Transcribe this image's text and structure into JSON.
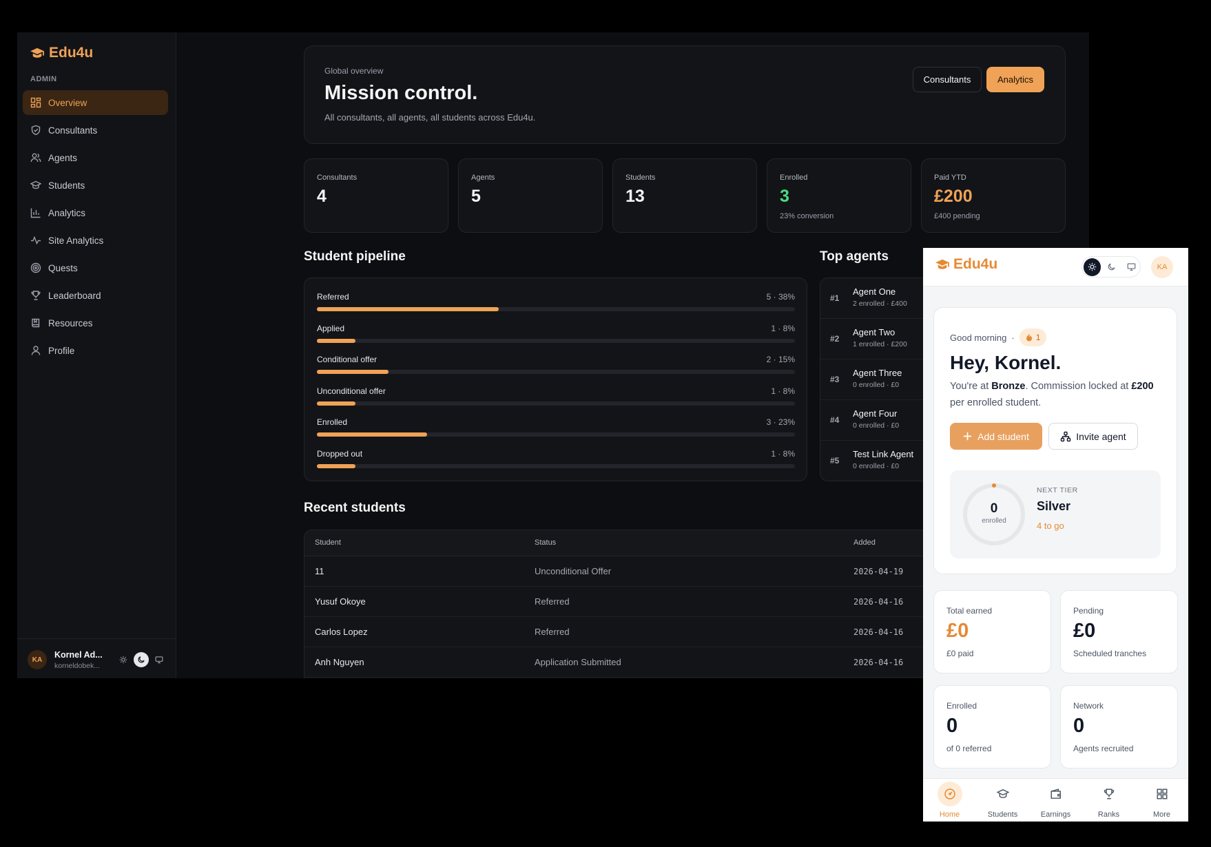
{
  "desktop": {
    "brand": "Edu4u",
    "sidebar": {
      "section_label": "ADMIN",
      "items": [
        {
          "label": "Overview",
          "icon": "grid-icon",
          "active": true
        },
        {
          "label": "Consultants",
          "icon": "shield-icon"
        },
        {
          "label": "Agents",
          "icon": "users-icon"
        },
        {
          "label": "Students",
          "icon": "graduation-cap-icon"
        },
        {
          "label": "Analytics",
          "icon": "bar-chart-icon"
        },
        {
          "label": "Site Analytics",
          "icon": "activity-icon"
        },
        {
          "label": "Quests",
          "icon": "target-icon"
        },
        {
          "label": "Leaderboard",
          "icon": "trophy-icon"
        },
        {
          "label": "Resources",
          "icon": "book-icon"
        },
        {
          "label": "Profile",
          "icon": "user-icon"
        }
      ],
      "user": {
        "initials": "KA",
        "name": "Kornel Ad...",
        "email": "korneldobek..."
      }
    },
    "hero": {
      "eyebrow": "Global overview",
      "title": "Mission control.",
      "subtitle": "All consultants, all agents, all students across Edu4u.",
      "consultants_button": "Consultants",
      "analytics_button": "Analytics"
    },
    "stats": [
      {
        "label": "Consultants",
        "value": "4",
        "sub": ""
      },
      {
        "label": "Agents",
        "value": "5",
        "sub": ""
      },
      {
        "label": "Students",
        "value": "13",
        "sub": ""
      },
      {
        "label": "Enrolled",
        "value": "3",
        "sub": "23% conversion"
      },
      {
        "label": "Paid YTD",
        "value": "£200",
        "sub": "£400 pending"
      }
    ],
    "pipeline": {
      "title": "Student pipeline",
      "rows": [
        {
          "label": "Referred",
          "value": "5 · 38%",
          "fraction": 0.38
        },
        {
          "label": "Applied",
          "value": "1 · 8%",
          "fraction": 0.08
        },
        {
          "label": "Conditional offer",
          "value": "2 · 15%",
          "fraction": 0.15
        },
        {
          "label": "Unconditional offer",
          "value": "1 · 8%",
          "fraction": 0.08
        },
        {
          "label": "Enrolled",
          "value": "3 · 23%",
          "fraction": 0.23
        },
        {
          "label": "Dropped out",
          "value": "1 · 8%",
          "fraction": 0.08
        }
      ]
    },
    "top_agents": {
      "title": "Top agents",
      "rows": [
        {
          "rank": "#1",
          "name": "Agent One",
          "meta": "2 enrolled · £400"
        },
        {
          "rank": "#2",
          "name": "Agent Two",
          "meta": "1 enrolled · £200"
        },
        {
          "rank": "#3",
          "name": "Agent Three",
          "meta": "0 enrolled · £0"
        },
        {
          "rank": "#4",
          "name": "Agent Four",
          "meta": "0 enrolled · £0"
        },
        {
          "rank": "#5",
          "name": "Test Link Agent",
          "meta": "0 enrolled · £0"
        }
      ]
    },
    "recent": {
      "title": "Recent students",
      "headers": {
        "student": "Student",
        "status": "Status",
        "added": "Added"
      },
      "rows": [
        {
          "student": "11",
          "status": "Unconditional Offer",
          "added": "2026-04-19"
        },
        {
          "student": "Yusuf Okoye",
          "status": "Referred",
          "added": "2026-04-16"
        },
        {
          "student": "Carlos Lopez",
          "status": "Referred",
          "added": "2026-04-16"
        },
        {
          "student": "Anh Nguyen",
          "status": "Application Submitted",
          "added": "2026-04-16"
        }
      ]
    }
  },
  "mobile": {
    "brand": "Edu4u",
    "avatar": "KA",
    "greeting": "Good morning",
    "greeting_sep": "·",
    "streak": "1",
    "title": "Hey, Kornel.",
    "desc_1": "You're at ",
    "desc_tier": "Bronze",
    "desc_2": ". Commission locked at ",
    "desc_amount": "£200",
    "desc_3": " per enrolled student.",
    "add_student": "Add student",
    "invite_agent": "Invite agent",
    "tier": {
      "count": "0",
      "count_label": "enrolled",
      "progress": 0,
      "eyebrow": "NEXT TIER",
      "name": "Silver",
      "to_go": "4 to go"
    },
    "stats": [
      {
        "label": "Total earned",
        "value": "£0",
        "sub": "£0 paid"
      },
      {
        "label": "Pending",
        "value": "£0",
        "sub": "Scheduled tranches"
      },
      {
        "label": "Enrolled",
        "value": "0",
        "sub": "of 0 referred"
      },
      {
        "label": "Network",
        "value": "0",
        "sub": "Agents recruited"
      }
    ],
    "tabs": [
      {
        "label": "Home",
        "icon": "gauge-icon",
        "active": true
      },
      {
        "label": "Students",
        "icon": "graduation-cap-icon"
      },
      {
        "label": "Earnings",
        "icon": "wallet-icon"
      },
      {
        "label": "Ranks",
        "icon": "trophy-icon"
      },
      {
        "label": "More",
        "icon": "grid-icon"
      }
    ]
  },
  "colors": {
    "accent": "#f0a256",
    "success": "#4ade80",
    "dark_bg": "#0d0e11",
    "light_bg": "#f4f5f7"
  }
}
